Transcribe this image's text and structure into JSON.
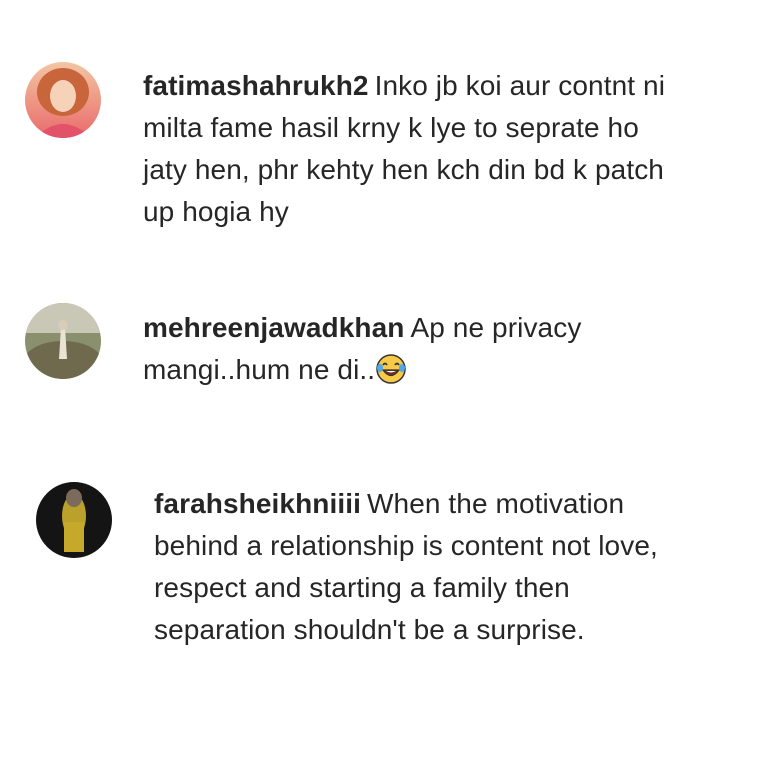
{
  "comments": [
    {
      "username": "fatimashahrukh2",
      "text": "Inko jb koi aur contnt ni milta fame hasil krny k lye to seprate ho jaty hen, phr kehty hen kch din bd k patch up hogia hy",
      "avatar_icon": "user-avatar-photo"
    },
    {
      "username": "mehreenjawadkhan",
      "text": "Ap ne privacy mangi..hum ne di..",
      "emoji": "😂",
      "avatar_icon": "user-avatar-photo"
    },
    {
      "username": "farahsheikhniiii",
      "text": "When the motivation behind a relationship is content not love, respect and starting a family then separation shouldn't be a surprise.",
      "avatar_icon": "user-avatar-photo"
    }
  ]
}
